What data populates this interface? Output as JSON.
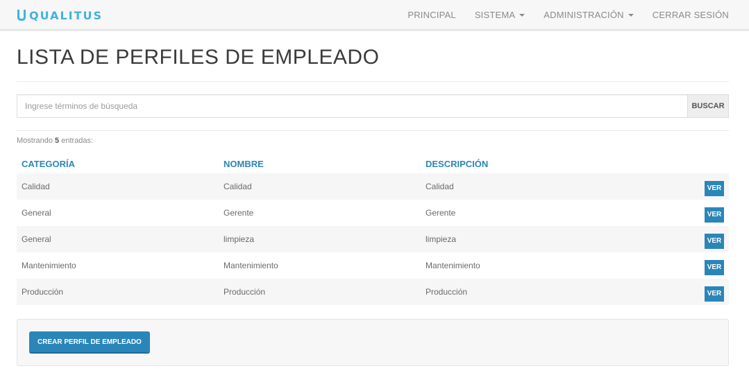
{
  "brand": {
    "name": "QUALITUS",
    "color": "#3fb3e0"
  },
  "nav": {
    "items": [
      {
        "label": "PRINCIPAL",
        "dropdown": false
      },
      {
        "label": "SISTEMA",
        "dropdown": true
      },
      {
        "label": "ADMINISTRACIÓN",
        "dropdown": true
      },
      {
        "label": "CERRAR SESIÓN",
        "dropdown": false
      }
    ]
  },
  "page": {
    "title": "LISTA DE PERFILES DE EMPLEADO"
  },
  "search": {
    "placeholder": "Ingrese términos de búsqueda",
    "value": "",
    "button_label": "BUSCAR"
  },
  "summary": {
    "prefix": "Mostrando",
    "count": "5",
    "suffix": "entradas:"
  },
  "table": {
    "columns": [
      "CATEGORÍA",
      "NOMBRE",
      "DESCRIPCIÓN"
    ],
    "rows": [
      {
        "categoria": "Calidad",
        "nombre": "Calidad",
        "descripcion": "Calidad",
        "action": "VER"
      },
      {
        "categoria": "General",
        "nombre": "Gerente",
        "descripcion": "Gerente",
        "action": "VER"
      },
      {
        "categoria": "General",
        "nombre": "limpieza",
        "descripcion": "limpieza",
        "action": "VER"
      },
      {
        "categoria": "Mantenimiento",
        "nombre": "Mantenimiento",
        "descripcion": "Mantenimiento",
        "action": "VER"
      },
      {
        "categoria": "Producción",
        "nombre": "Producción",
        "descripcion": "Producción",
        "action": "VER"
      }
    ]
  },
  "footer": {
    "create_label": "CREAR PERFIL DE EMPLEADO"
  },
  "colors": {
    "accent": "#2a86b8",
    "brand": "#3fb3e0"
  }
}
